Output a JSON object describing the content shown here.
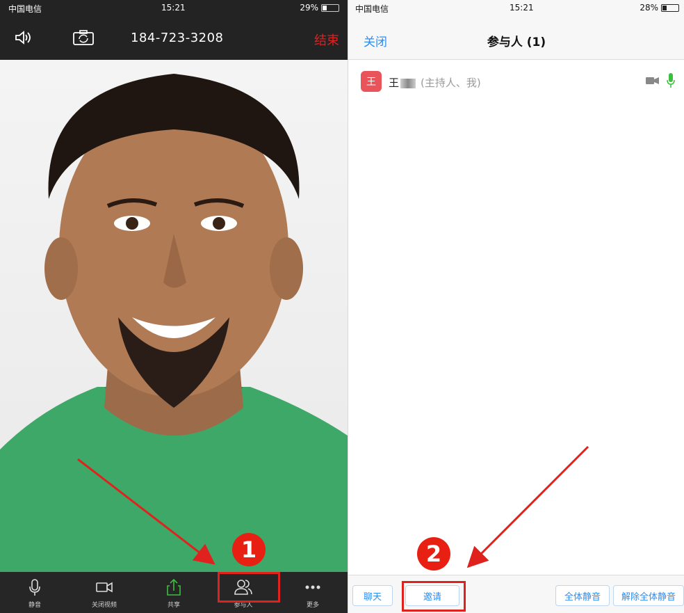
{
  "left_phone": {
    "status": {
      "carrier": "中国电信",
      "time": "15:21",
      "battery": "29%",
      "battery_level": 0.29
    },
    "header": {
      "number": "184-723-3208",
      "end_label": "结束"
    },
    "toolbar": {
      "items": [
        {
          "label": "静音",
          "icon": "mic-icon"
        },
        {
          "label": "关闭视频",
          "icon": "video-camera-icon"
        },
        {
          "label": "共享",
          "icon": "share-icon"
        },
        {
          "label": "参与人",
          "icon": "participants-icon"
        },
        {
          "label": "更多",
          "icon": "more-icon"
        }
      ]
    },
    "annotation_number": "1"
  },
  "right_phone": {
    "status": {
      "carrier": "中国电信",
      "time": "15:21",
      "battery": "28%",
      "battery_level": 0.28
    },
    "header": {
      "close_label": "关闭",
      "title": "参与人 (1)"
    },
    "participant": {
      "avatar_letter": "王",
      "name": "王",
      "role": "(主持人、我)"
    },
    "bottom": {
      "chat_label": "聊天",
      "invite_label": "邀请",
      "mute_all_label": "全体静音",
      "unmute_all_label": "解除全体静音"
    },
    "annotation_number": "2"
  },
  "colors": {
    "accent_blue": "#2d8cf0",
    "annotation_red": "#e0221e",
    "end_red": "#e02020",
    "mic_green": "#3cbf3c",
    "avatar_red": "#e9545a"
  }
}
